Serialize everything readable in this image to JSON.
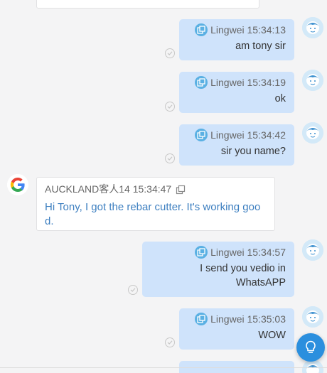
{
  "messages": [
    {
      "sender": "Lingwei",
      "time": "15:34:13",
      "text": "am tony sir",
      "direction": "out",
      "icon": "copy-icon",
      "status_icon": "check-circle-icon"
    },
    {
      "sender": "Lingwei",
      "time": "15:34:19",
      "text": "ok",
      "direction": "out",
      "icon": "copy-icon",
      "status_icon": "check-circle-icon"
    },
    {
      "sender": "Lingwei",
      "time": "15:34:42",
      "text": "sir you name?",
      "direction": "out",
      "icon": "copy-icon",
      "status_icon": "check-circle-icon"
    },
    {
      "sender": "AUCKLAND客人14",
      "time": "15:34:47",
      "text": "Hi Tony, I got the rebar cutter. It's working good.",
      "direction": "in",
      "icon": "copy-icon",
      "avatar_icon": "google-icon"
    },
    {
      "sender": "Lingwei",
      "time": "15:34:57",
      "text": "I send you vedio in WhatsAPP",
      "direction": "out",
      "icon": "copy-icon",
      "status_icon": "check-circle-icon"
    },
    {
      "sender": "Lingwei",
      "time": "15:35:03",
      "text": "WOW",
      "direction": "out",
      "icon": "copy-icon",
      "status_icon": "check-circle-icon"
    }
  ],
  "floating_button": {
    "icon": "lightbulb-icon"
  },
  "colors": {
    "outgoing_bubble": "#cfe3fb",
    "incoming_text": "#3d7fc0",
    "accent": "#2b8fde"
  }
}
